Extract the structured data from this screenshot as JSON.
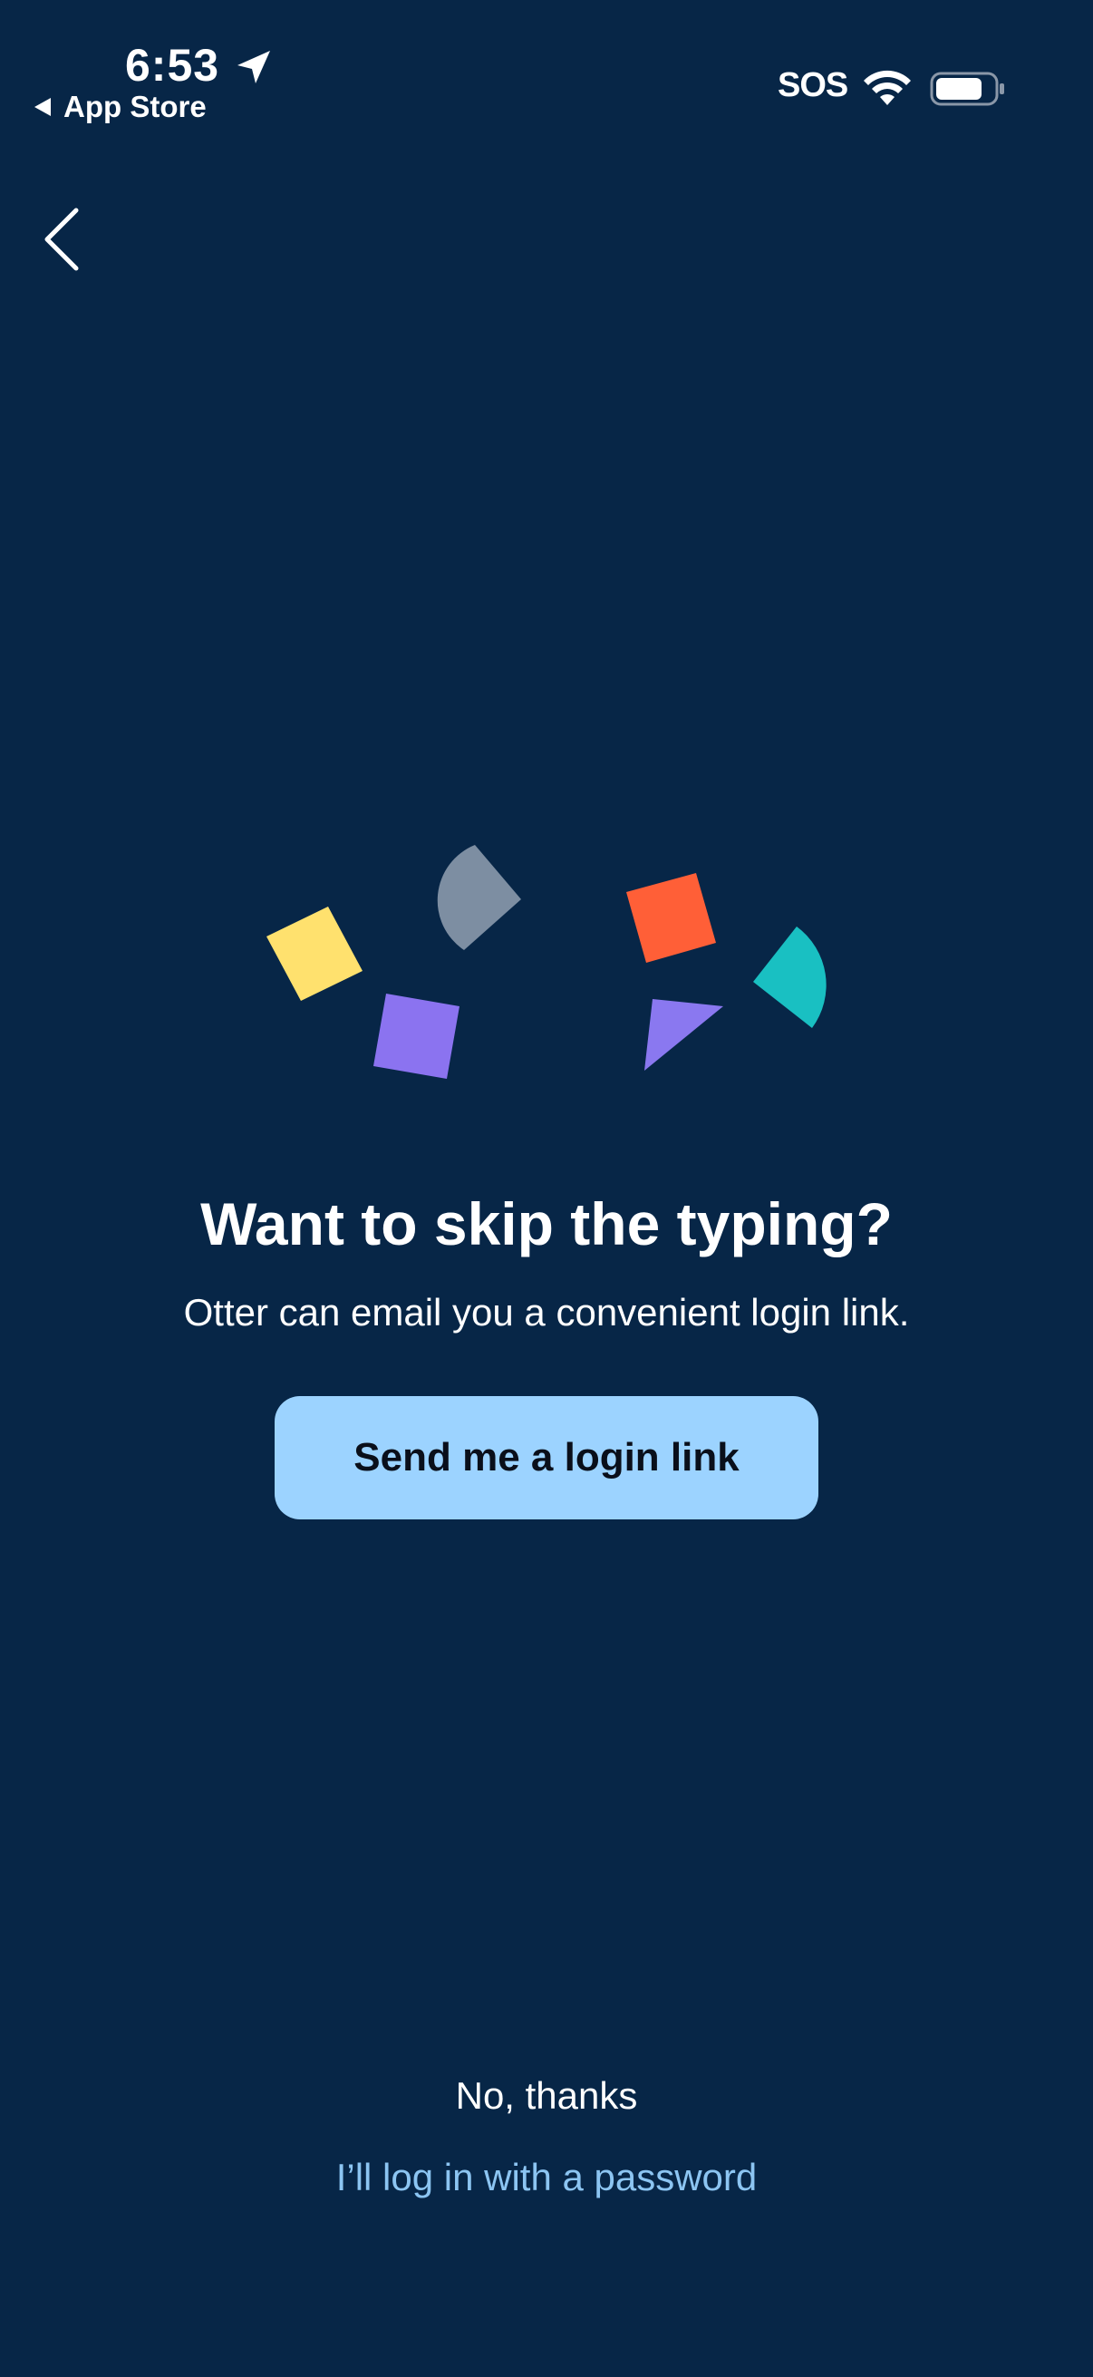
{
  "status_bar": {
    "time": "6:53",
    "back_app_label": "App Store",
    "carrier_text": "SOS",
    "icons": [
      "location-arrow-icon",
      "back-triangle-icon",
      "wifi-icon",
      "battery-icon"
    ]
  },
  "nav": {
    "back_icon": "chevron-left-icon"
  },
  "illustration": {
    "colors": {
      "yellow": "#FFE16E",
      "purple": "#8B73F0",
      "gray": "#7D8EA2",
      "orange": "#FF5F37",
      "violet": "#8A78F0",
      "teal": "#19C0C2"
    }
  },
  "content": {
    "headline": "Want to skip the typing?",
    "subtext": "Otter can email you a convenient login link.",
    "primary_button": "Send me a login link",
    "secondary_action": "No, thanks",
    "password_link": "I’ll log in with a password"
  },
  "theme": {
    "background": "#072647",
    "button_bg": "#9CD3FF",
    "link_color": "#8CC5F2",
    "text": "#FFFFFF"
  }
}
